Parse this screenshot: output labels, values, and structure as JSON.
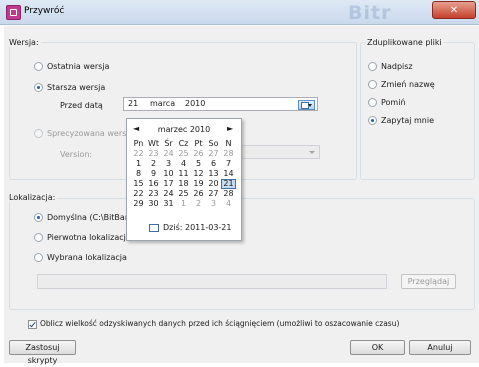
{
  "window": {
    "title": "Przywróć",
    "brand": "Bitr",
    "close_glyph": "✕"
  },
  "version_group": {
    "label": "Wersja:",
    "options": {
      "latest": "Ostatnia wersja",
      "older": "Starsza wersja",
      "specific": "Sprecyzowana wers"
    },
    "selected": "older",
    "date_label": "Przed datą",
    "date": {
      "day": "21",
      "month": "marca",
      "year": "2010"
    },
    "version_label": "Version:"
  },
  "duplicates_group": {
    "label": "Zduplikowane pliki",
    "options": {
      "overwrite": "Nadpisz",
      "rename": "Zmień nazwę",
      "skip": "Pomiń",
      "ask": "Zapytaj mnie"
    },
    "selected": "ask"
  },
  "location_group": {
    "label": "Lokalizacja:",
    "options": {
      "default": "Domyślna (C:\\BitBar",
      "original": "Pierwotna lokalizacja",
      "chosen": "Wybrana lokalizacja"
    },
    "selected": "default",
    "path_value": "",
    "browse_button": "Przeglądaj"
  },
  "calendar": {
    "title": "marzec 2010",
    "prev_glyph": "◄",
    "next_glyph": "►",
    "weekdays": [
      "Pn",
      "Wt",
      "Śr",
      "Cz",
      "Pt",
      "So",
      "N"
    ],
    "weeks": [
      [
        "22",
        "23",
        "24",
        "25",
        "26",
        "27",
        "28"
      ],
      [
        "1",
        "2",
        "3",
        "4",
        "5",
        "6",
        "7"
      ],
      [
        "8",
        "9",
        "10",
        "11",
        "12",
        "13",
        "14"
      ],
      [
        "15",
        "16",
        "17",
        "18",
        "19",
        "20",
        "21"
      ],
      [
        "22",
        "23",
        "24",
        "25",
        "26",
        "27",
        "28"
      ],
      [
        "29",
        "30",
        "31",
        "1",
        "2",
        "3",
        "4"
      ]
    ],
    "other_month": [
      [
        true,
        true,
        true,
        true,
        true,
        true,
        true
      ],
      [
        false,
        false,
        false,
        false,
        false,
        false,
        false
      ],
      [
        false,
        false,
        false,
        false,
        false,
        false,
        false
      ],
      [
        false,
        false,
        false,
        false,
        false,
        false,
        false
      ],
      [
        false,
        false,
        false,
        false,
        false,
        false,
        false
      ],
      [
        false,
        false,
        false,
        true,
        true,
        true,
        true
      ]
    ],
    "selected_day": "21",
    "today_text": "Dziś: 2011-03-21"
  },
  "estimate_checkbox": {
    "label": "Oblicz wielkość odzyskiwanych danych przed ich ściągnięciem (umożliwi to oszacowanie czasu)",
    "checked": true
  },
  "buttons": {
    "scripts": "Zastosuj skrypty",
    "ok": "OK",
    "cancel": "Anuluj"
  }
}
